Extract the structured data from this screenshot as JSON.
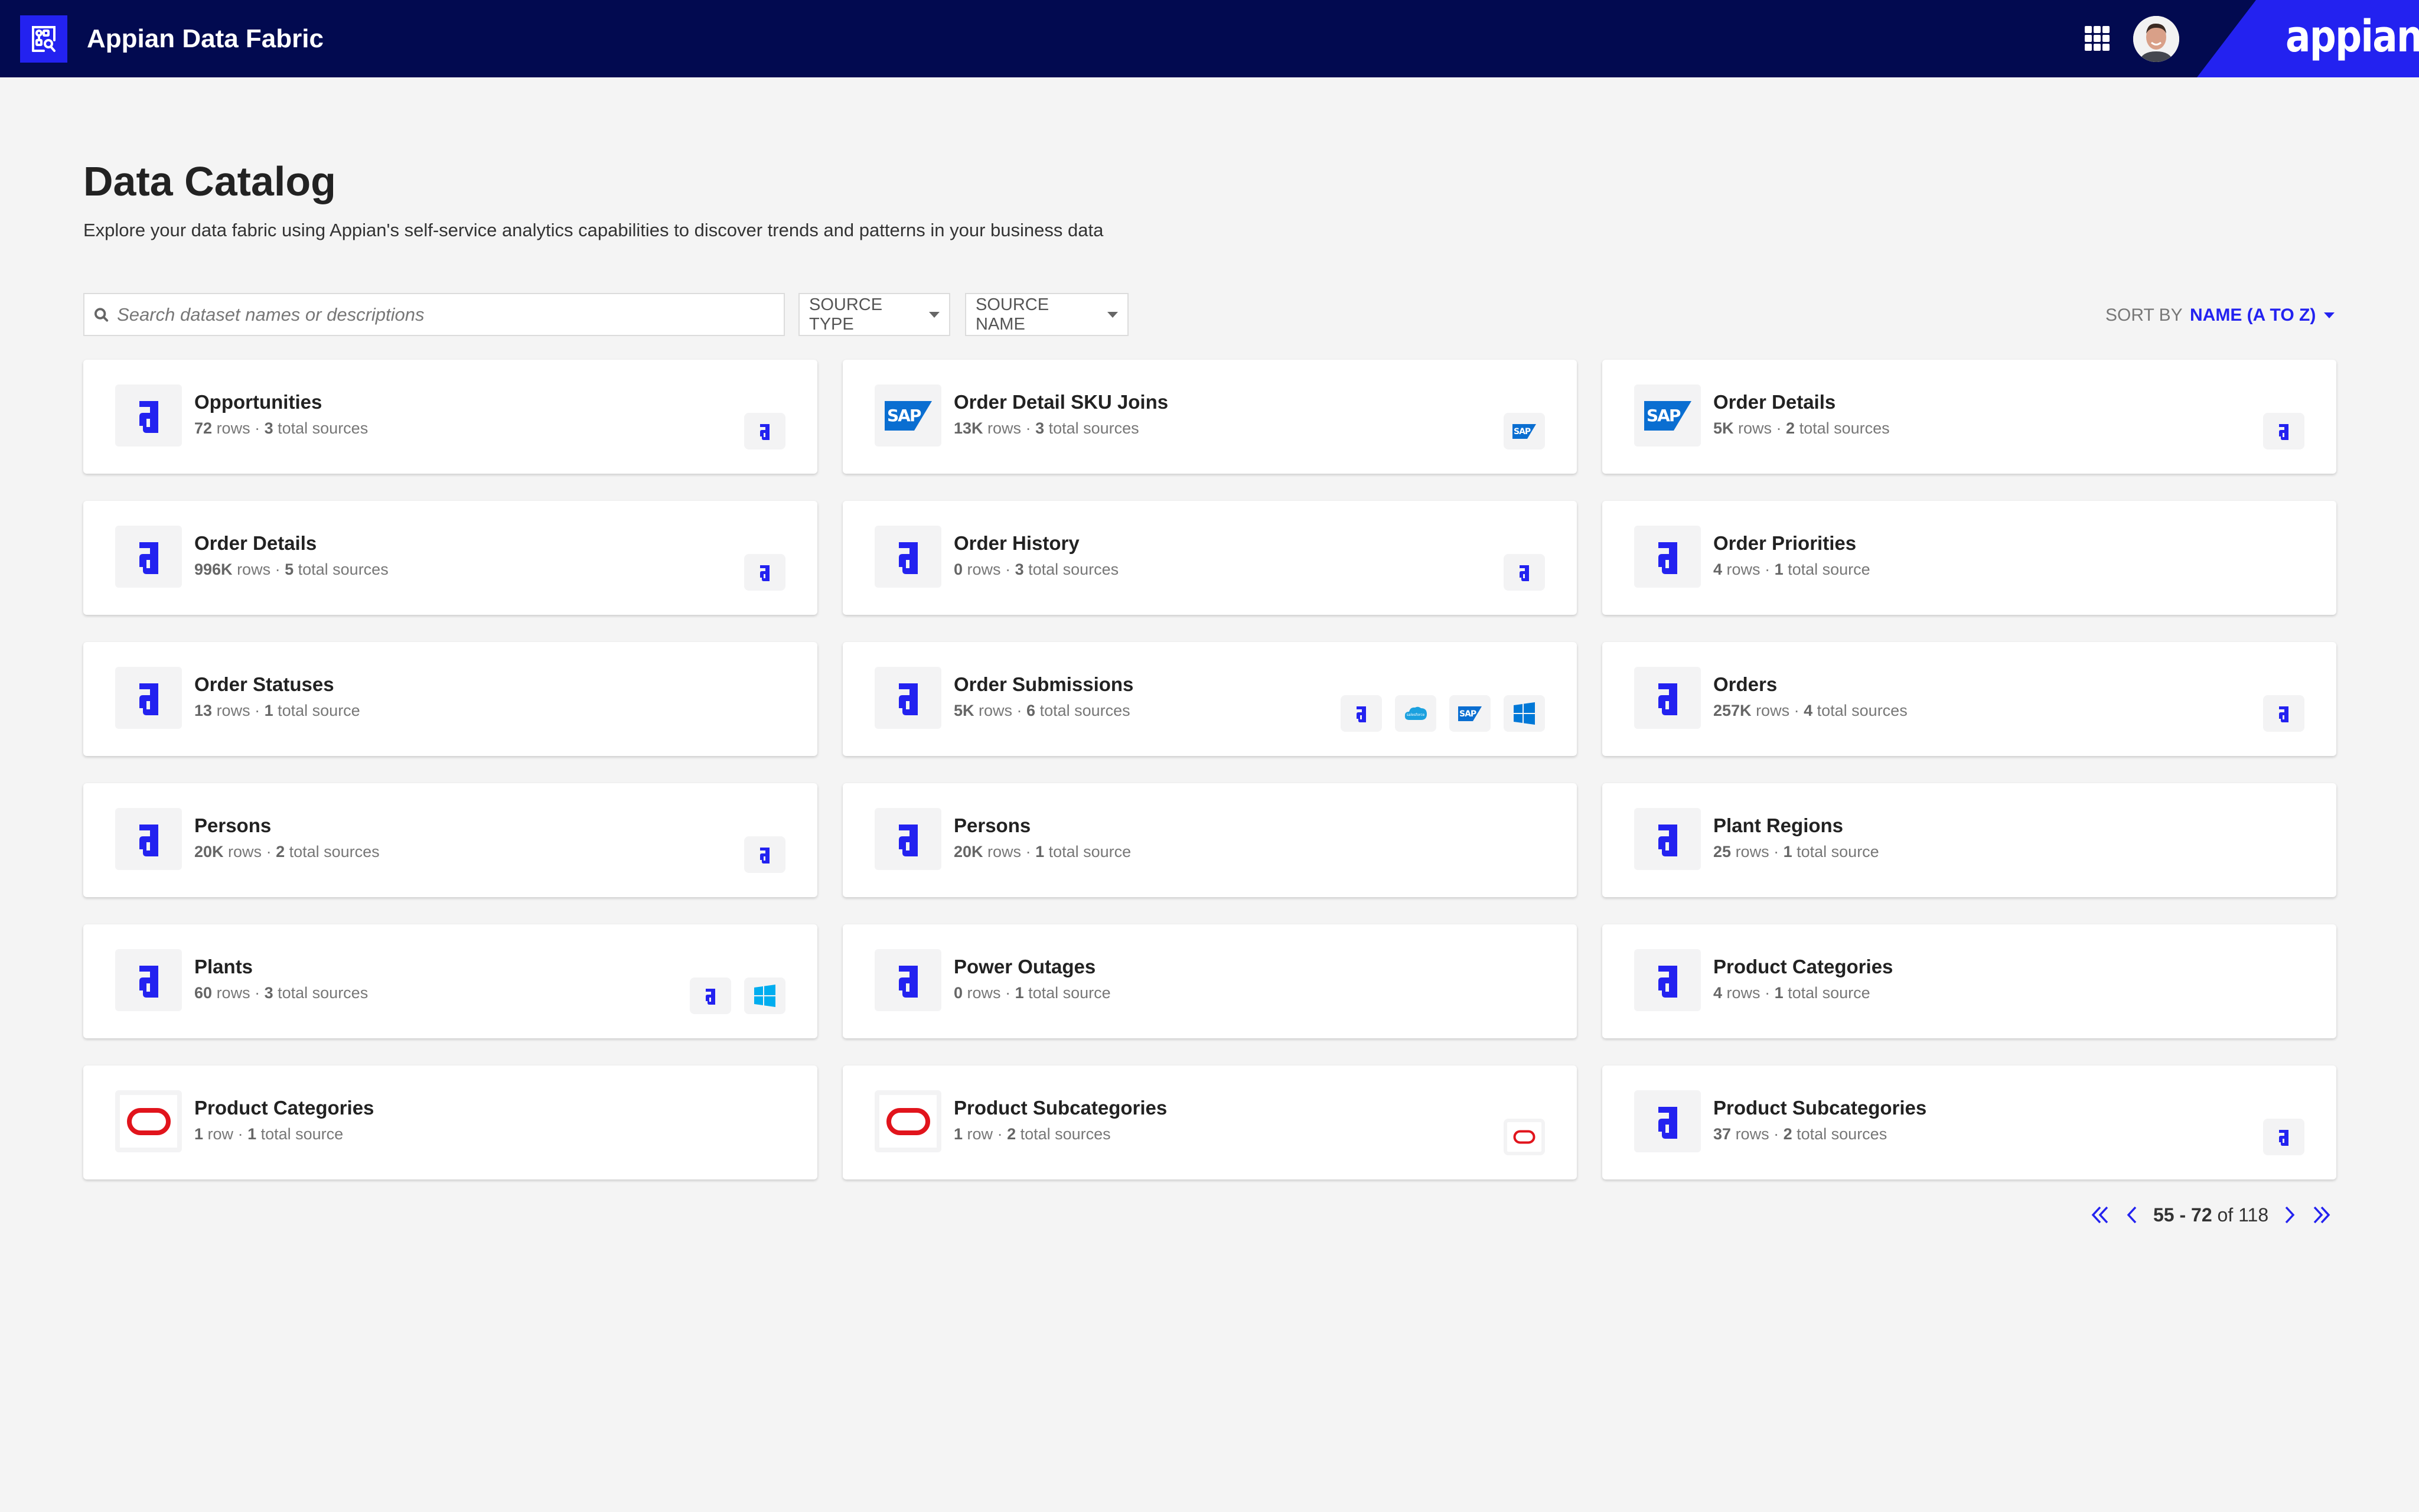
{
  "header": {
    "app_title": "Appian Data Fabric",
    "brand": "appian",
    "app_logo_icon": "data-fabric-icon",
    "apps_icon": "apps-grid-icon",
    "avatar": "user-avatar"
  },
  "page": {
    "title": "Data Catalog",
    "description": "Explore your data fabric using Appian's self-service analytics capabilities to discover trends and patterns in your business data"
  },
  "filters": {
    "search_placeholder": "Search dataset names or descriptions",
    "search_value": "",
    "source_type_label": "SOURCE TYPE",
    "source_name_label": "SOURCE NAME",
    "sort_label": "SORT BY",
    "sort_value": "NAME (A TO Z)"
  },
  "colors": {
    "header_bg": "#020a50",
    "accent": "#2322f0",
    "sap_blue": "#0a6ed1",
    "oracle_red": "#e1141c",
    "salesforce_blue": "#1ba1df",
    "windows_blue": "#0078d7"
  },
  "datasets": [
    {
      "name": "Opportunities",
      "rows": "72",
      "rows_unit": "rows",
      "sources": "3",
      "sources_unit": "total sources",
      "type": "appian",
      "source_icons": [
        "appian"
      ]
    },
    {
      "name": "Order Detail SKU Joins",
      "rows": "13K",
      "rows_unit": "rows",
      "sources": "3",
      "sources_unit": "total sources",
      "type": "sap",
      "source_icons": [
        "sap"
      ]
    },
    {
      "name": "Order Details",
      "rows": "5K",
      "rows_unit": "rows",
      "sources": "2",
      "sources_unit": "total sources",
      "type": "sap",
      "source_icons": [
        "appian"
      ]
    },
    {
      "name": "Order Details",
      "rows": "996K",
      "rows_unit": "rows",
      "sources": "5",
      "sources_unit": "total sources",
      "type": "appian",
      "source_icons": [
        "appian"
      ]
    },
    {
      "name": "Order History",
      "rows": "0",
      "rows_unit": "rows",
      "sources": "3",
      "sources_unit": "total sources",
      "type": "appian",
      "source_icons": [
        "appian"
      ]
    },
    {
      "name": "Order Priorities",
      "rows": "4",
      "rows_unit": "rows",
      "sources": "1",
      "sources_unit": "total source",
      "type": "appian",
      "source_icons": []
    },
    {
      "name": "Order Statuses",
      "rows": "13",
      "rows_unit": "rows",
      "sources": "1",
      "sources_unit": "total source",
      "type": "appian",
      "source_icons": []
    },
    {
      "name": "Order Submissions",
      "rows": "5K",
      "rows_unit": "rows",
      "sources": "6",
      "sources_unit": "total sources",
      "type": "appian",
      "source_icons": [
        "appian",
        "salesforce",
        "sap",
        "windows"
      ]
    },
    {
      "name": "Orders",
      "rows": "257K",
      "rows_unit": "rows",
      "sources": "4",
      "sources_unit": "total sources",
      "type": "appian",
      "source_icons": [
        "appian"
      ]
    },
    {
      "name": "Persons",
      "rows": "20K",
      "rows_unit": "rows",
      "sources": "2",
      "sources_unit": "total sources",
      "type": "appian",
      "source_icons": [
        "appian"
      ]
    },
    {
      "name": "Persons",
      "rows": "20K",
      "rows_unit": "rows",
      "sources": "1",
      "sources_unit": "total source",
      "type": "appian",
      "source_icons": []
    },
    {
      "name": "Plant Regions",
      "rows": "25",
      "rows_unit": "rows",
      "sources": "1",
      "sources_unit": "total source",
      "type": "appian",
      "source_icons": []
    },
    {
      "name": "Plants",
      "rows": "60",
      "rows_unit": "rows",
      "sources": "3",
      "sources_unit": "total sources",
      "type": "appian",
      "source_icons": [
        "appian",
        "windows-light"
      ]
    },
    {
      "name": "Power Outages",
      "rows": "0",
      "rows_unit": "rows",
      "sources": "1",
      "sources_unit": "total source",
      "type": "appian",
      "source_icons": []
    },
    {
      "name": "Product Categories",
      "rows": "4",
      "rows_unit": "rows",
      "sources": "1",
      "sources_unit": "total source",
      "type": "appian",
      "source_icons": []
    },
    {
      "name": "Product Categories",
      "rows": "1",
      "rows_unit": "row",
      "sources": "1",
      "sources_unit": "total source",
      "type": "oracle",
      "source_icons": []
    },
    {
      "name": "Product Subcategories",
      "rows": "1",
      "rows_unit": "row",
      "sources": "2",
      "sources_unit": "total sources",
      "type": "oracle",
      "source_icons": [
        "oracle"
      ]
    },
    {
      "name": "Product Subcategories",
      "rows": "37",
      "rows_unit": "rows",
      "sources": "2",
      "sources_unit": "total sources",
      "type": "appian",
      "source_icons": [
        "appian"
      ]
    }
  ],
  "pagination": {
    "range_start": "55",
    "range_sep": " - ",
    "range_end": "72",
    "of_label": "of",
    "total": "118"
  }
}
